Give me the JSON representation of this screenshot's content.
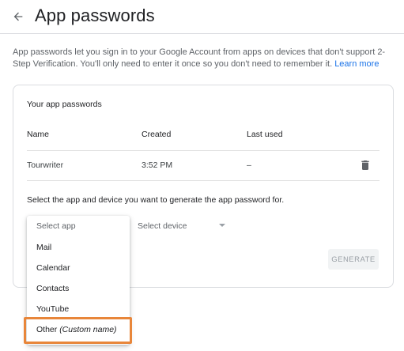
{
  "header": {
    "back_icon": "arrow-left-icon",
    "title": "App passwords"
  },
  "description": {
    "text": "App passwords let you sign in to your Google Account from apps on devices that don't support 2-Step Verification. You'll only need to enter it once so you don't need to remember it.",
    "link": "Learn more"
  },
  "card": {
    "title": "Your app passwords",
    "columns": [
      "Name",
      "Created",
      "Last used"
    ],
    "rows": [
      {
        "name": "Tourwriter",
        "created": "3:52 PM",
        "last_used": "–",
        "delete_icon": "trash-icon"
      }
    ],
    "instruction": "Select the app and device you want to generate the app password for.",
    "device_select": {
      "placeholder": "Select device",
      "icon": "caret-down-icon"
    },
    "generate_label": "GENERATE"
  },
  "app_menu": {
    "header": "Select app",
    "items": [
      "Mail",
      "Calendar",
      "Contacts",
      "YouTube"
    ],
    "other": {
      "label": "Other",
      "suffix": "(Custom name)"
    }
  },
  "colors": {
    "accent_link": "#1a73e8",
    "highlight_border": "#e8863a",
    "divider": "#dadce0"
  }
}
